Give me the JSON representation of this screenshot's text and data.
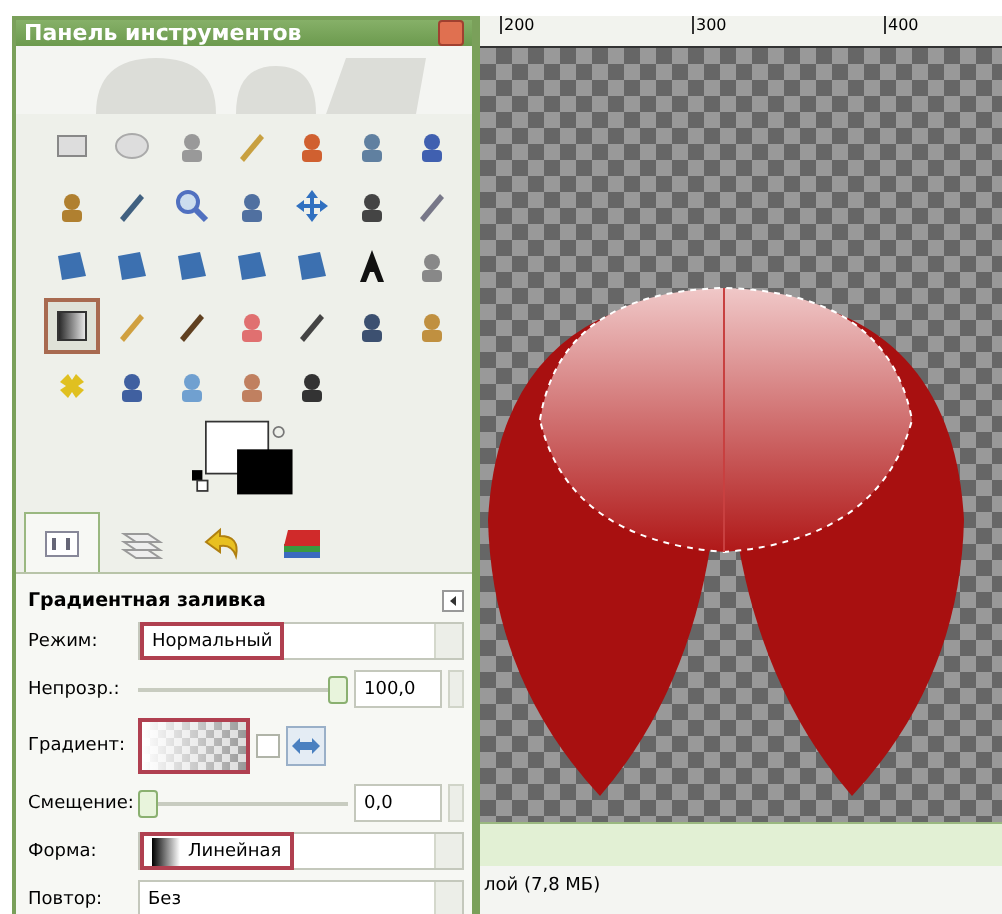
{
  "window": {
    "title": "Панель инструментов"
  },
  "tools": [
    {
      "selected": false
    },
    {
      "selected": false
    },
    {
      "selected": false
    },
    {
      "selected": false
    },
    {
      "selected": false
    },
    {
      "selected": false
    },
    {
      "selected": false
    },
    {
      "selected": false
    },
    {
      "selected": false
    },
    {
      "selected": false
    },
    {
      "selected": false
    },
    {
      "selected": false
    },
    {
      "selected": false
    },
    {
      "selected": false
    },
    {
      "selected": false
    },
    {
      "selected": false
    },
    {
      "selected": false
    },
    {
      "selected": false
    },
    {
      "selected": false
    },
    {
      "selected": false
    },
    {
      "selected": false
    },
    {
      "selected": true
    },
    {
      "selected": false
    },
    {
      "selected": false
    },
    {
      "selected": false
    },
    {
      "selected": false
    },
    {
      "selected": false
    },
    {
      "selected": false
    },
    {
      "selected": false
    },
    {
      "selected": false
    },
    {
      "selected": false
    },
    {
      "selected": false
    },
    {
      "selected": false
    }
  ],
  "tabs": [
    {
      "selected": true
    },
    {
      "selected": false
    },
    {
      "selected": false
    },
    {
      "selected": false
    }
  ],
  "tool_options": {
    "title": "Градиентная заливка",
    "mode": {
      "label": "Режим:",
      "value": "Нормальный",
      "highlighted": true
    },
    "opacity": {
      "label": "Непрозр.:",
      "level": 1,
      "value": "100,0"
    },
    "gradient": {
      "label": "Градиент:",
      "highlighted": true,
      "reverse_checked": false
    },
    "offset": {
      "label": "Смещение:",
      "level": 0,
      "value": "0,0"
    },
    "shape": {
      "label": "Форма:",
      "value": "Линейная",
      "highlighted": true
    },
    "repeat": {
      "label": "Повтор:",
      "value": "Без",
      "highlighted": false
    }
  },
  "canvas": {
    "ruler_labels": [
      "200",
      "300",
      "400"
    ],
    "status": "лой (7,8 МБ)"
  }
}
